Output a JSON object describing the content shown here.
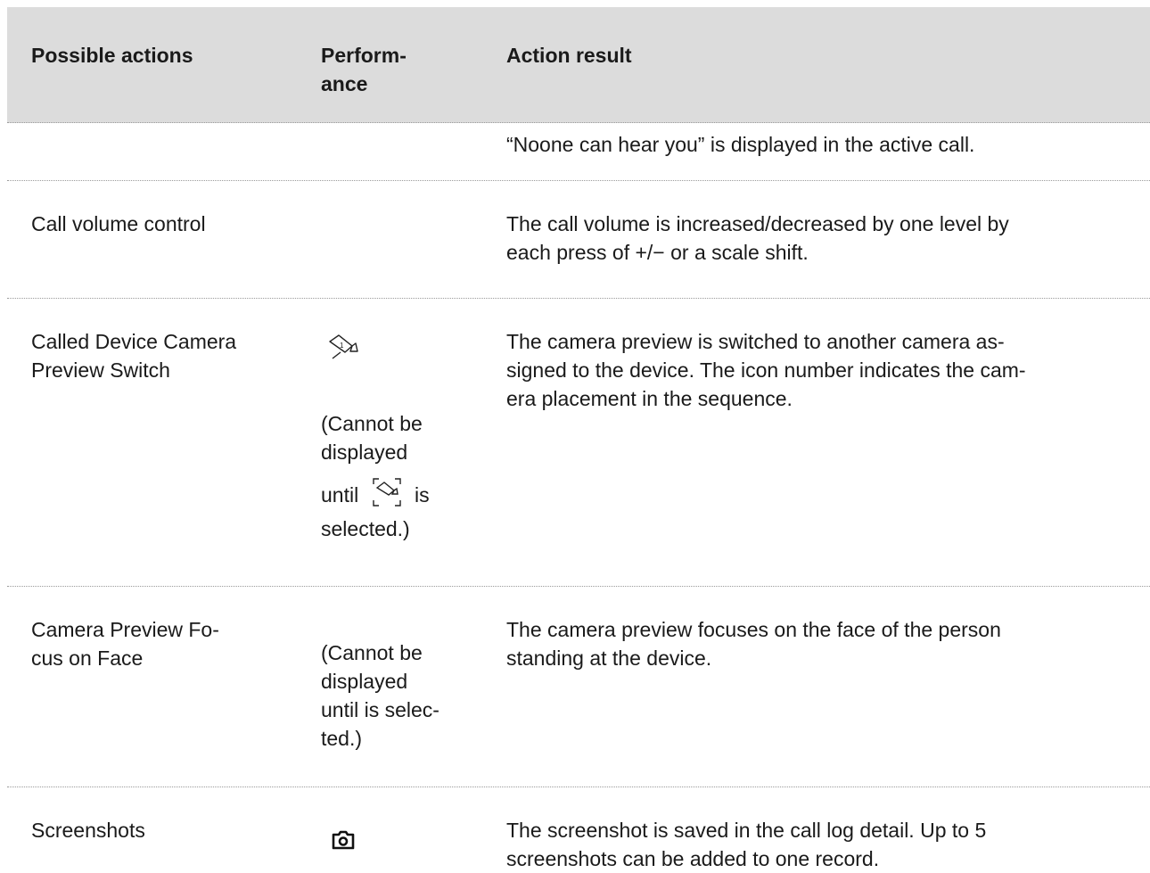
{
  "table": {
    "headers": {
      "actions": "Possible actions",
      "performance_line1": "Perform-",
      "performance_line2": "ance",
      "result": "Action result"
    },
    "rows": [
      {
        "action": "",
        "result": "“Noone can hear you” is displayed in the active call."
      },
      {
        "action": "Call volume control",
        "result_line1": "The call volume is increased/decreased by one level by",
        "result_line2": "each press of +/− or a scale shift."
      },
      {
        "action_line1": "Called Device Camera",
        "action_line2": "Preview Switch",
        "performance_icon": "camera-switch-icon",
        "performance_note_line1": "(Cannot be",
        "performance_note_line2": "displayed",
        "performance_note_until": "until",
        "performance_note_icon": "camera-focus-icon",
        "performance_note_is": "is",
        "performance_note_line4": "selected.)",
        "result_line1": "The camera preview is switched to another camera as-",
        "result_line2": "signed to the device. The icon number indicates the cam-",
        "result_line3": "era placement in the sequence."
      },
      {
        "action_line1": "Camera Preview Fo-",
        "action_line2": "cus on Face",
        "performance_note_line1": "(Cannot be",
        "performance_note_line2": "displayed",
        "performance_note_line3": "until is selec-",
        "performance_note_line4": "ted.)",
        "result_line1": "The camera preview focuses on the face of the person",
        "result_line2": "standing at the device."
      },
      {
        "action": "Screenshots",
        "performance_icon": "camera-snapshot-icon",
        "result_line1": "The screenshot is saved in the call log detail. Up to 5",
        "result_line2": "screenshots can be added to one record."
      }
    ]
  }
}
